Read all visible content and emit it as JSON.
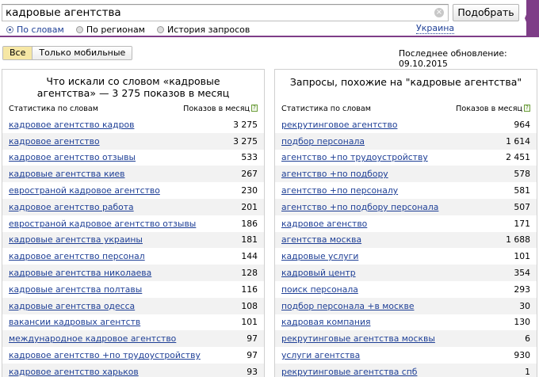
{
  "search": {
    "value": "кадровые агентства",
    "clear_glyph": "×",
    "submit_label": "Подобрать",
    "modes": [
      {
        "label": "По словам",
        "active": true
      },
      {
        "label": "По регионам",
        "active": false
      },
      {
        "label": "История запросов",
        "active": false
      }
    ],
    "region": "Украина"
  },
  "filters": {
    "all_label": "Все",
    "mobile_label": "Только мобильные",
    "active": "all"
  },
  "last_update": "Последнее обновление: 09.10.2015",
  "left": {
    "title": "Что искали со словом «кадровые агентства» — 3 275 показов в месяц",
    "col_keyword": "Статистика по словам",
    "col_count": "Показов в месяц",
    "help": "?",
    "rows": [
      {
        "phrase": "кадровое агентство кадров",
        "count": "3 275"
      },
      {
        "phrase": "кадровое агентство",
        "count": "3 275"
      },
      {
        "phrase": "кадровое агентство отзывы",
        "count": "533"
      },
      {
        "phrase": "кадровые агентства киев",
        "count": "267"
      },
      {
        "phrase": "евространой кадровое агентство",
        "count": "230"
      },
      {
        "phrase": "кадровое агентство работа",
        "count": "201"
      },
      {
        "phrase": "евространой кадровое агентство отзывы",
        "count": "186"
      },
      {
        "phrase": "кадровые агентства украины",
        "count": "181"
      },
      {
        "phrase": "кадровое агентство персонал",
        "count": "144"
      },
      {
        "phrase": "кадровые агентства николаева",
        "count": "128"
      },
      {
        "phrase": "кадровые агентства полтавы",
        "count": "116"
      },
      {
        "phrase": "кадровые агентства одесса",
        "count": "108"
      },
      {
        "phrase": "вакансии кадровых агентств",
        "count": "101"
      },
      {
        "phrase": "международное кадровое агентство",
        "count": "97"
      },
      {
        "phrase": "кадровое агентство +по трудоустройству",
        "count": "97"
      },
      {
        "phrase": "кадровое агентство харьков",
        "count": "93"
      }
    ]
  },
  "right": {
    "title": "Запросы, похожие на \"кадровые агентства\"",
    "col_keyword": "Статистика по словам",
    "col_count": "Показов в месяц",
    "help": "?",
    "rows": [
      {
        "phrase": "рекрутинговое агентство",
        "count": "964"
      },
      {
        "phrase": "подбор персонала",
        "count": "1 614"
      },
      {
        "phrase": "агентство +по трудоустройству",
        "count": "2 451"
      },
      {
        "phrase": "агентство +по подбору",
        "count": "578"
      },
      {
        "phrase": "агентство +по персоналу",
        "count": "581"
      },
      {
        "phrase": "агентство +по подбору персонала",
        "count": "507"
      },
      {
        "phrase": "кадровое агенство",
        "count": "171"
      },
      {
        "phrase": "агентства москва",
        "count": "1 688"
      },
      {
        "phrase": "кадровые услуги",
        "count": "101"
      },
      {
        "phrase": "кадровый центр",
        "count": "354"
      },
      {
        "phrase": "поиск персонала",
        "count": "293"
      },
      {
        "phrase": "подбор персонала +в москве",
        "count": "30"
      },
      {
        "phrase": "кадровая компания",
        "count": "130"
      },
      {
        "phrase": "рекрутинговые агентства москвы",
        "count": "6"
      },
      {
        "phrase": "услуги агентства",
        "count": "930"
      },
      {
        "phrase": "рекрутинговые агентства спб",
        "count": "1"
      }
    ]
  }
}
